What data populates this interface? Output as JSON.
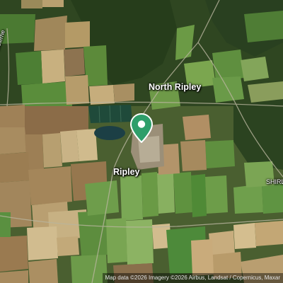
{
  "map": {
    "type": "satellite",
    "place_labels": {
      "north_ripley": "North Ripley",
      "ripley": "Ripley",
      "shirley": "SHIRL"
    },
    "road_label": "Lower Bisterne",
    "marker": {
      "icon": "location-pin-icon",
      "color": "#2e9e6a"
    },
    "attribution": "Map data ©2026 Imagery ©2026 Airbus, Landsat / Copernicus, Maxar"
  }
}
